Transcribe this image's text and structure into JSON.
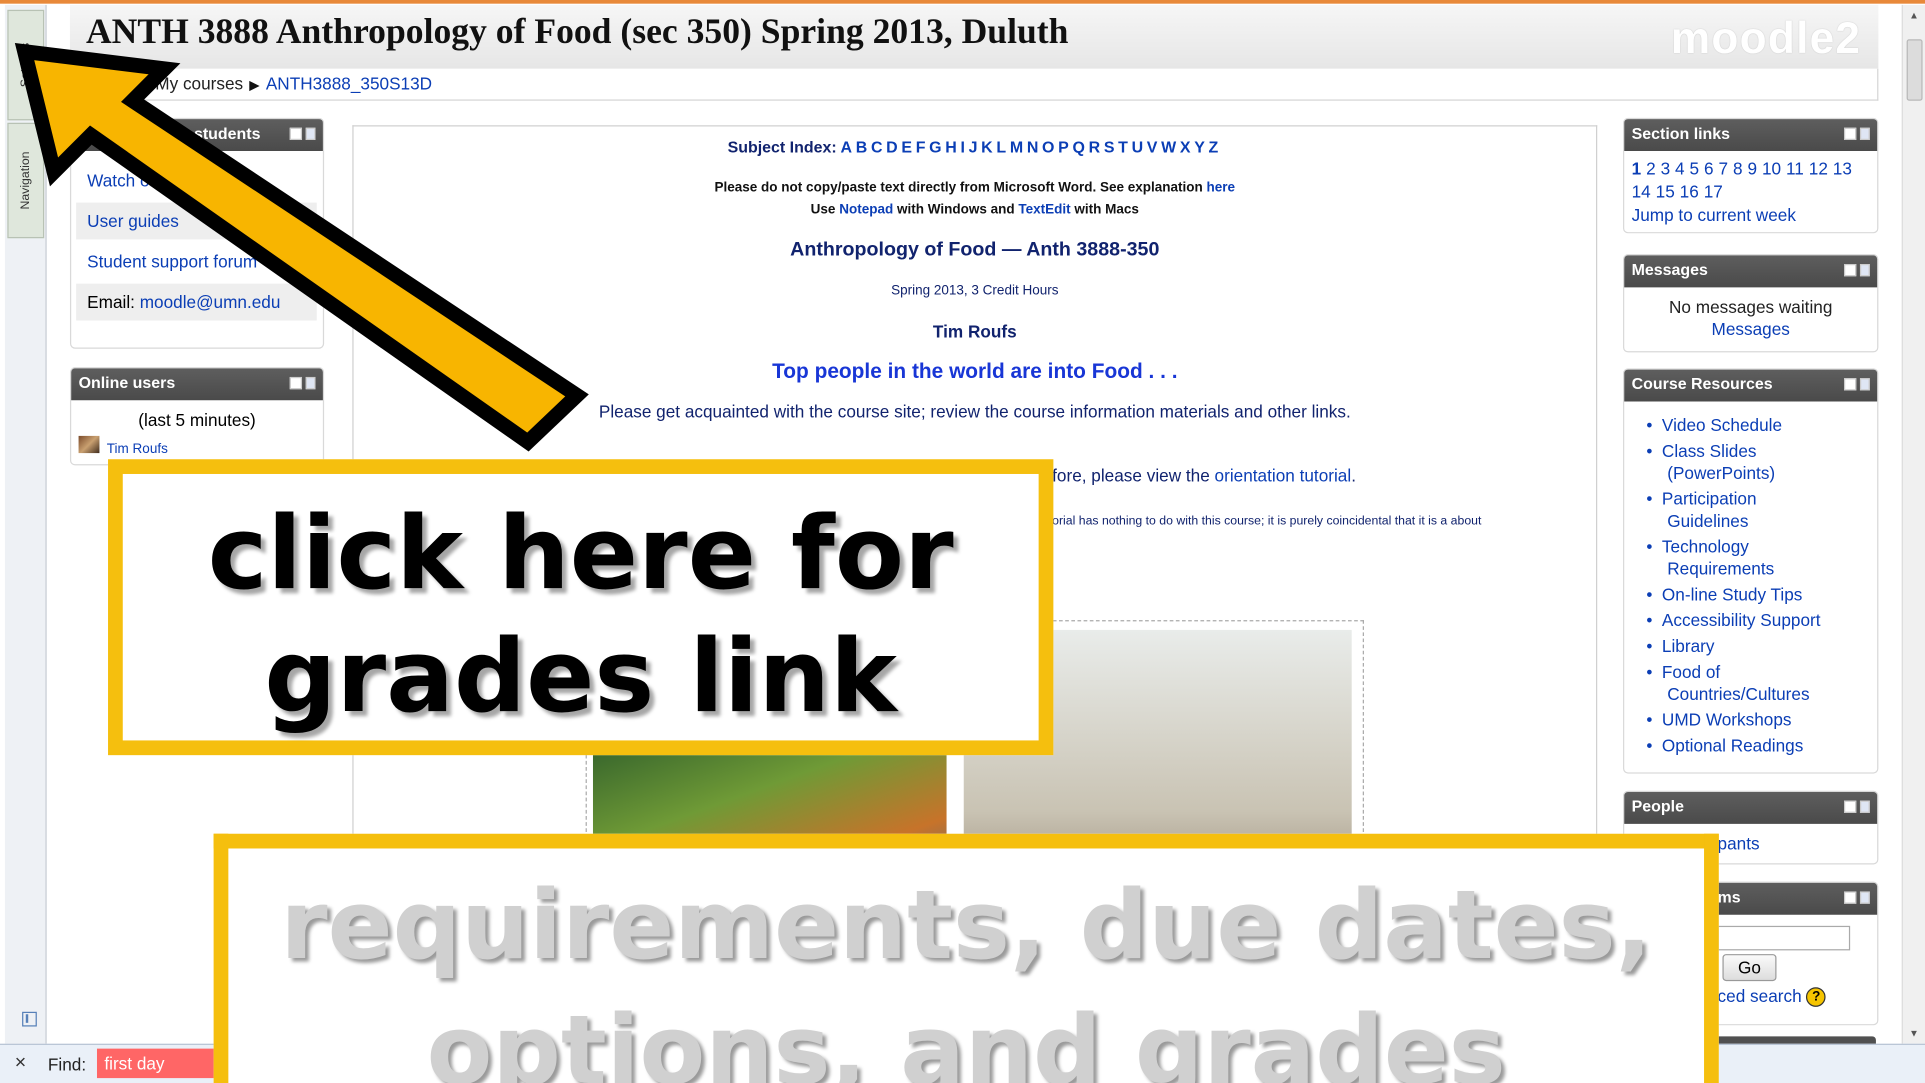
{
  "header": {
    "course_title": "ANTH 3888 Anthropology of Food (sec 350) Spring 2013, Duluth",
    "logo": "moodle2"
  },
  "breadcrumb": {
    "items": [
      "My courses",
      "ANTH3888_350S13D"
    ]
  },
  "sidetabs": {
    "settings": "Settings",
    "navigation": "Navigation"
  },
  "left_blocks": {
    "students": {
      "title": "students",
      "links": [
        "Watch orientation",
        "User guides",
        "Student support forum"
      ],
      "email_label": "Email:",
      "email": "moodle@umn.edu"
    },
    "online_users": {
      "title": "Online users",
      "period": "(last 5 minutes)",
      "users": [
        "Tim Roufs"
      ]
    }
  },
  "main": {
    "subject_index_label": "Subject Index:",
    "letters": [
      "A",
      "B",
      "C",
      "D",
      "E",
      "F",
      "G",
      "H",
      "I",
      "J",
      "K",
      "L",
      "M",
      "N",
      "O",
      "P",
      "Q",
      "R",
      "S",
      "T",
      "U",
      "V",
      "W",
      "X",
      "Y",
      "Z"
    ],
    "notice1_text": "Please do not copy/paste text directly from Microsoft Word.  See explanation ",
    "notice1_link": "here",
    "notice2_a": "Use ",
    "notice2_notepad": "Notepad",
    "notice2_b": " with Windows and ",
    "notice2_textedit": "TextEdit",
    "notice2_c": " with Macs",
    "course_heading": "Anthropology of Food — Anth 3888-350",
    "term": "Spring 2013, 3 Credit Hours",
    "instructor": "Tim Roufs",
    "tagline": "Top people in the world are into Food . . .",
    "intro": "Please get acquainted with the course site; review the course information materials and other links.",
    "orientation_prefix": "fore, please view the ",
    "orientation_link": "orientation tutorial",
    "disclaimer": "orial has nothing to do with this course; it is purely coincidental that it is a about"
  },
  "right_blocks": {
    "section_links": {
      "title": "Section links",
      "numbers_row1": [
        "1",
        "2",
        "3",
        "4",
        "5",
        "6",
        "7",
        "8",
        "9",
        "10",
        "11",
        "12",
        "13"
      ],
      "numbers_row2": [
        "14",
        "15",
        "16",
        "17"
      ],
      "jump": "Jump to current week"
    },
    "messages": {
      "title": "Messages",
      "status": "No messages waiting",
      "link": "Messages"
    },
    "course_resources": {
      "title": "Course Resources",
      "items": [
        "Video Schedule",
        "Class Slides",
        "(PowerPoints)",
        "Participation",
        "Guidelines",
        "Technology",
        "Requirements",
        "On-line Study Tips",
        "Accessibility Support",
        "Library",
        "Food of",
        "Countries/Cultures",
        "UMD Workshops",
        "Optional Readings"
      ]
    },
    "people": {
      "title": "People",
      "link": "pants"
    },
    "search": {
      "title": "ms",
      "go": "Go",
      "advanced": "ced search"
    }
  },
  "findbar": {
    "label": "Find:",
    "value": "first day"
  },
  "annotations": {
    "callout1_line1": "click here for",
    "callout1_line2": "grades link",
    "callout2_line1": "requirements, due dates,",
    "callout2_line2": "options, and grades"
  },
  "colors": {
    "accent_yellow": "#f5bf0e",
    "link_blue": "#0b3eb5",
    "block_header": "#505050"
  }
}
